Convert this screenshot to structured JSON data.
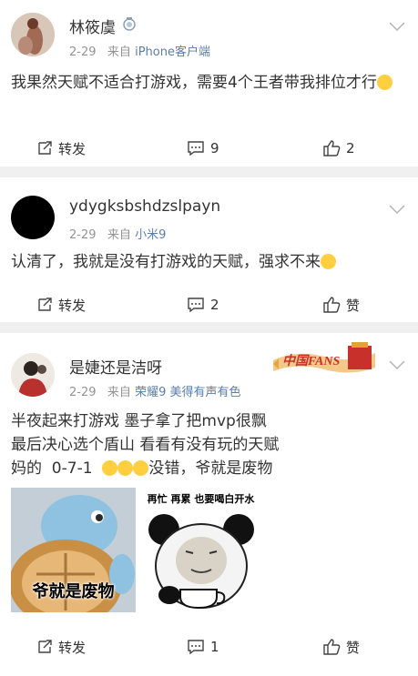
{
  "posts": [
    {
      "name": "林筱虞",
      "time": "2-29",
      "from_label": "来自",
      "source": "iPhone客户端",
      "text": "我果然天赋不适合打游戏，需要4个王者带我排位才行",
      "actions": {
        "repost": "转发",
        "comment": "9",
        "like": "2"
      }
    },
    {
      "name": "ydygksbshdzslpayn",
      "time": "2-29",
      "from_label": "来自",
      "source": "小米9",
      "text": "认清了，我就是没有打游戏的天赋，强求不来",
      "actions": {
        "repost": "转发",
        "comment": "2",
        "like": "赞"
      }
    },
    {
      "name": "是婕还是洁呀",
      "time": "2-29",
      "from_label": "来自",
      "source": "荣耀9 美得有声有色",
      "badge": "中国FANS",
      "text_lines": [
        "半夜起来打游戏  墨子拿了把mvp很飘",
        "最后决心选个盾山 看看有没有玩的天赋",
        "妈的  0-7-1  ",
        "没错，爷就是废物"
      ],
      "image1_caption": "爷就是废物",
      "image2_caption": "再忙 再累 也要喝白开水",
      "actions": {
        "repost": "转发",
        "comment": "1",
        "like": "赞"
      }
    }
  ],
  "colors": {
    "link": "#5b7ea8",
    "meta": "#939393",
    "separator": "#f0f0f0",
    "text": "#333333"
  }
}
